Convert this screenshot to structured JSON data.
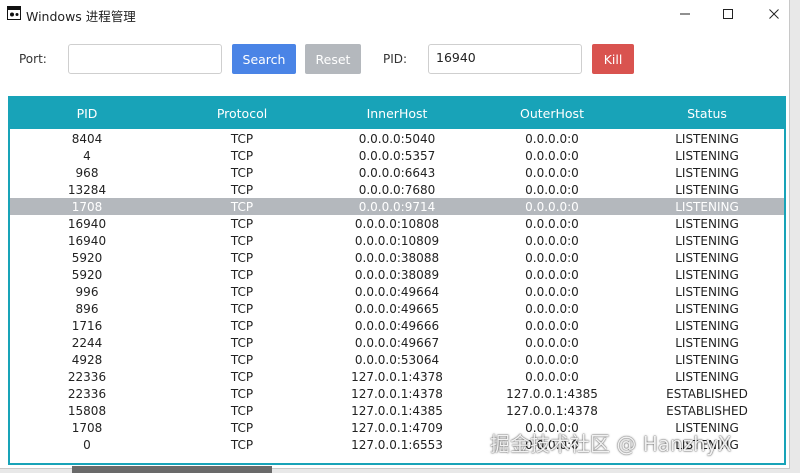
{
  "window": {
    "title": "Windows 进程管理",
    "icon": "app-window-icon"
  },
  "toolbar": {
    "port_label": "Port:",
    "port_value": "",
    "search_label": "Search",
    "reset_label": "Reset",
    "pid_label": "PID:",
    "pid_value": "16940",
    "kill_label": "Kill"
  },
  "table": {
    "columns": [
      "PID",
      "Protocol",
      "InnerHost",
      "OuterHost",
      "Status"
    ],
    "selected_row": 4,
    "rows": [
      [
        "8404",
        "TCP",
        "0.0.0.0:5040",
        "0.0.0.0:0",
        "LISTENING"
      ],
      [
        "4",
        "TCP",
        "0.0.0.0:5357",
        "0.0.0.0:0",
        "LISTENING"
      ],
      [
        "968",
        "TCP",
        "0.0.0.0:6643",
        "0.0.0.0:0",
        "LISTENING"
      ],
      [
        "13284",
        "TCP",
        "0.0.0.0:7680",
        "0.0.0.0:0",
        "LISTENING"
      ],
      [
        "1708",
        "TCP",
        "0.0.0.0:9714",
        "0.0.0.0:0",
        "LISTENING"
      ],
      [
        "16940",
        "TCP",
        "0.0.0.0:10808",
        "0.0.0.0:0",
        "LISTENING"
      ],
      [
        "16940",
        "TCP",
        "0.0.0.0:10809",
        "0.0.0.0:0",
        "LISTENING"
      ],
      [
        "5920",
        "TCP",
        "0.0.0.0:38088",
        "0.0.0.0:0",
        "LISTENING"
      ],
      [
        "5920",
        "TCP",
        "0.0.0.0:38089",
        "0.0.0.0:0",
        "LISTENING"
      ],
      [
        "996",
        "TCP",
        "0.0.0.0:49664",
        "0.0.0.0:0",
        "LISTENING"
      ],
      [
        "896",
        "TCP",
        "0.0.0.0:49665",
        "0.0.0.0:0",
        "LISTENING"
      ],
      [
        "1716",
        "TCP",
        "0.0.0.0:49666",
        "0.0.0.0:0",
        "LISTENING"
      ],
      [
        "2244",
        "TCP",
        "0.0.0.0:49667",
        "0.0.0.0:0",
        "LISTENING"
      ],
      [
        "4928",
        "TCP",
        "0.0.0.0:53064",
        "0.0.0.0:0",
        "LISTENING"
      ],
      [
        "22336",
        "TCP",
        "127.0.0.1:4378",
        "0.0.0.0:0",
        "LISTENING"
      ],
      [
        "22336",
        "TCP",
        "127.0.0.1:4378",
        "127.0.0.1:4385",
        "ESTABLISHED"
      ],
      [
        "15808",
        "TCP",
        "127.0.0.1:4385",
        "127.0.0.1:4378",
        "ESTABLISHED"
      ],
      [
        "1708",
        "TCP",
        "127.0.0.1:4709",
        "0.0.0.0:0",
        "LISTENING"
      ],
      [
        "0",
        "TCP",
        "127.0.0.1:6553",
        "0.0.0.0:0",
        "LISTENING"
      ]
    ]
  },
  "watermark": "掘金技术社区 @ HanzhyX",
  "colors": {
    "accent": "#18a3b8",
    "search": "#4a84e6",
    "reset": "#b4b8bd",
    "kill": "#d9534f",
    "selected_row": "#b4b8bd"
  }
}
